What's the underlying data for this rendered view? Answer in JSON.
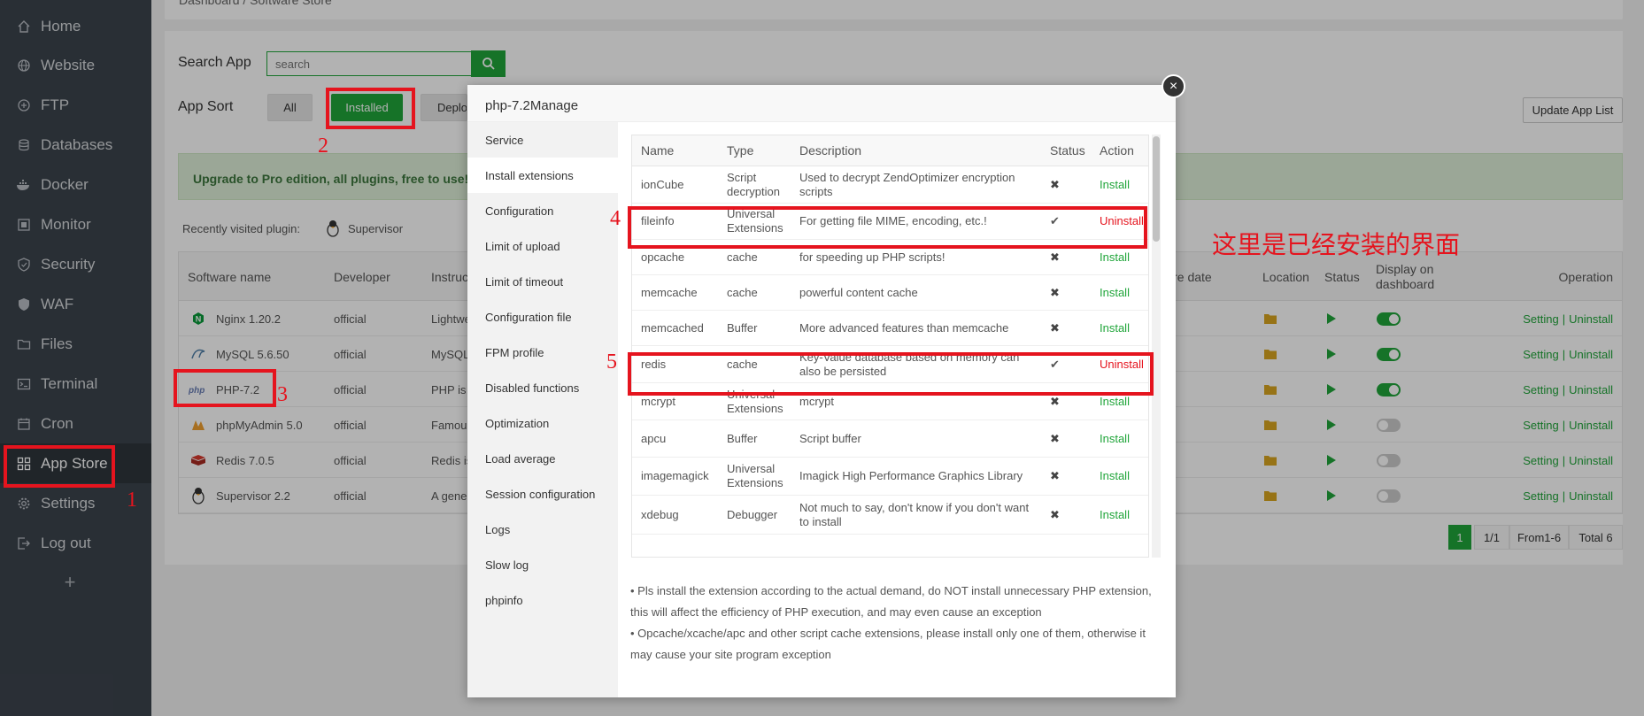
{
  "sidebar": {
    "items": [
      {
        "label": "Home",
        "icon": "home-icon"
      },
      {
        "label": "Website",
        "icon": "globe-icon"
      },
      {
        "label": "FTP",
        "icon": "ftp-icon"
      },
      {
        "label": "Databases",
        "icon": "database-icon"
      },
      {
        "label": "Docker",
        "icon": "docker-icon"
      },
      {
        "label": "Monitor",
        "icon": "monitor-icon"
      },
      {
        "label": "Security",
        "icon": "shield-icon"
      },
      {
        "label": "WAF",
        "icon": "waf-icon"
      },
      {
        "label": "Files",
        "icon": "folder-icon"
      },
      {
        "label": "Terminal",
        "icon": "terminal-icon"
      },
      {
        "label": "Cron",
        "icon": "clock-icon"
      },
      {
        "label": "App Store",
        "icon": "grid-icon"
      },
      {
        "label": "Settings",
        "icon": "gear-icon"
      },
      {
        "label": "Log out",
        "icon": "logout-icon"
      }
    ],
    "active": "App Store",
    "add_label": "+"
  },
  "breadcrumb": {
    "home": "Dashboard",
    "separator": "/",
    "current": "Software Store"
  },
  "toolbar": {
    "search_label": "Search App",
    "search_placeholder": "search",
    "sort_label": "App Sort",
    "sort_all": "All",
    "sort_installed": "Installed",
    "sort_deploy": "Deplo",
    "update_list": "Update App List"
  },
  "promo": {
    "text": "Upgrade to Pro edition, all plugins, free to use!"
  },
  "recent": {
    "label": "Recently visited plugin:",
    "plugin": "Supervisor"
  },
  "apps_table": {
    "headers": {
      "name": "Software name",
      "developer": "Developer",
      "instructions": "Instruc",
      "expire": "ire date",
      "location": "Location",
      "status": "Status",
      "display": "Display on dashboard",
      "operation": "Operation"
    },
    "rows": [
      {
        "name": "Nginx 1.20.2",
        "developer": "official",
        "instructions": "Lightwe",
        "dashboard": true,
        "setting": "Setting",
        "sep": "|",
        "uninstall": "Uninstall"
      },
      {
        "name": "MySQL 5.6.50",
        "developer": "official",
        "instructions": "MySQL",
        "dashboard": true,
        "setting": "Setting",
        "sep": "|",
        "uninstall": "Uninstall"
      },
      {
        "name": "PHP-7.2",
        "developer": "official",
        "instructions": "PHP is",
        "dashboard": true,
        "setting": "Setting",
        "sep": "|",
        "uninstall": "Uninstall"
      },
      {
        "name": "phpMyAdmin 5.0",
        "developer": "official",
        "instructions": "Famous",
        "dashboard": false,
        "setting": "Setting",
        "sep": "|",
        "uninstall": "Uninstall"
      },
      {
        "name": "Redis 7.0.5",
        "developer": "official",
        "instructions": "Redis is",
        "dashboard": false,
        "setting": "Setting",
        "sep": "|",
        "uninstall": "Uninstall"
      },
      {
        "name": "Supervisor 2.2",
        "developer": "official",
        "instructions": "A gene",
        "dashboard": false,
        "setting": "Setting",
        "sep": "|",
        "uninstall": "Uninstall"
      }
    ]
  },
  "pagination": {
    "current": "1",
    "pages": "1/1",
    "range": "From1-6",
    "total": "Total 6"
  },
  "modal": {
    "title": "php-7.2Manage",
    "close": "×",
    "menu": [
      "Service",
      "Install extensions",
      "Configuration",
      "Limit of upload",
      "Limit of timeout",
      "Configuration file",
      "FPM profile",
      "Disabled functions",
      "Optimization",
      "Load average",
      "Session configuration",
      "Logs",
      "Slow log",
      "phpinfo"
    ],
    "active_menu": "Install extensions",
    "ext_headers": {
      "name": "Name",
      "type": "Type",
      "description": "Description",
      "status": "Status",
      "action": "Action"
    },
    "extensions": [
      {
        "name": "ionCube",
        "type": "Script decryption",
        "description": "Used to decrypt ZendOptimizer encryption scripts",
        "status": "✖",
        "action": "Install",
        "installed": false
      },
      {
        "name": "fileinfo",
        "type": "Universal Extensions",
        "description": "For getting file MIME, encoding, etc.!",
        "status": "✔",
        "action": "Uninstall",
        "installed": true
      },
      {
        "name": "opcache",
        "type": "cache",
        "description": "for speeding up PHP scripts!",
        "status": "✖",
        "action": "Install",
        "installed": false
      },
      {
        "name": "memcache",
        "type": "cache",
        "description": "powerful content cache",
        "status": "✖",
        "action": "Install",
        "installed": false
      },
      {
        "name": "memcached",
        "type": "Buffer",
        "description": "More advanced features than memcache",
        "status": "✖",
        "action": "Install",
        "installed": false
      },
      {
        "name": "redis",
        "type": "cache",
        "description": "Key-Value database based on memory can also be persisted",
        "status": "✔",
        "action": "Uninstall",
        "installed": true
      },
      {
        "name": "mcrypt",
        "type": "Universal Extensions",
        "description": "mcrypt",
        "status": "✖",
        "action": "Install",
        "installed": false
      },
      {
        "name": "apcu",
        "type": "Buffer",
        "description": "Script buffer",
        "status": "✖",
        "action": "Install",
        "installed": false
      },
      {
        "name": "imagemagick",
        "type": "Universal Extensions",
        "description": "Imagick High Performance Graphics Library",
        "status": "✖",
        "action": "Install",
        "installed": false
      },
      {
        "name": "xdebug",
        "type": "Debugger",
        "description": "Not much to say, don't know if you don't want to install",
        "status": "✖",
        "action": "Install",
        "installed": false
      }
    ],
    "notes": [
      "Pls install the extension according to the actual demand, do NOT install unnecessary PHP extension, this will affect the efficiency of PHP execution, and may even cause an exception",
      "Opcache/xcache/apc and other script cache extensions, please install only one of them, otherwise it may cause your site program exception"
    ]
  },
  "annotations": {
    "n1": "1",
    "n2": "2",
    "n3": "3",
    "n4": "4",
    "n5": "5",
    "chinese_note": "这里是已经安装的界面"
  },
  "colors": {
    "accent": "#20a53a",
    "sidebar": "#3c444d",
    "highlight": "#e5141e"
  }
}
